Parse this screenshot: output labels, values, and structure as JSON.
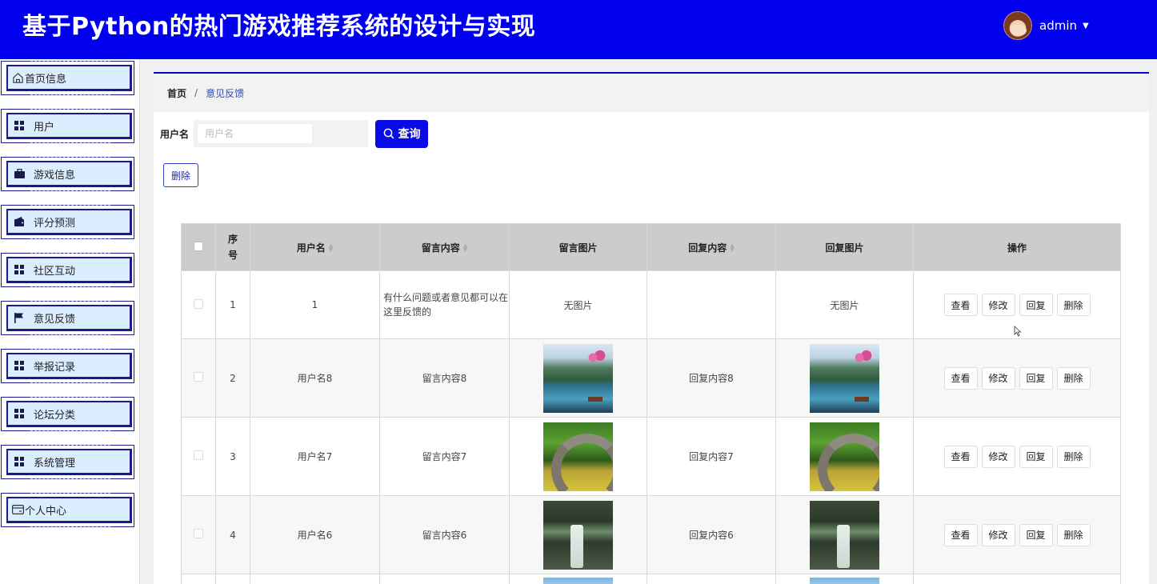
{
  "header": {
    "title": "基于Python的热门游戏推荐系统的设计与实现",
    "username": "admin"
  },
  "sidebar": {
    "items": [
      {
        "label": "首页信息",
        "icon": "home-icon"
      },
      {
        "label": "用户",
        "icon": "grid-icon"
      },
      {
        "label": "游戏信息",
        "icon": "briefcase-icon"
      },
      {
        "label": "评分预测",
        "icon": "wallet-icon"
      },
      {
        "label": "社区互动",
        "icon": "grid-icon"
      },
      {
        "label": "意见反馈",
        "icon": "flag-icon"
      },
      {
        "label": "举报记录",
        "icon": "grid-icon"
      },
      {
        "label": "论坛分类",
        "icon": "grid-icon"
      },
      {
        "label": "系统管理",
        "icon": "grid-icon"
      },
      {
        "label": "个人中心",
        "icon": "card-icon"
      }
    ]
  },
  "breadcrumb": {
    "home": "首页",
    "separator": "/",
    "current": "意见反馈"
  },
  "search": {
    "label": "用户名",
    "placeholder": "用户名",
    "value": "",
    "button": "查询"
  },
  "toolbar": {
    "delete_label": "删除"
  },
  "table": {
    "columns": [
      "序号",
      "用户名",
      "留言内容",
      "留言图片",
      "回复内容",
      "回复图片",
      "操作"
    ],
    "no_image_text": "无图片",
    "actions": [
      "查看",
      "修改",
      "回复",
      "删除"
    ],
    "rows": [
      {
        "index": "1",
        "username": "1",
        "message": "有什么问题或者意见都可以在这里反馈的",
        "message_image": "",
        "reply": "",
        "reply_image": ""
      },
      {
        "index": "2",
        "username": "用户名8",
        "message": "留言内容8",
        "message_image": "landscape-lake-image",
        "reply": "回复内容8",
        "reply_image": "landscape-lake-image"
      },
      {
        "index": "3",
        "username": "用户名7",
        "message": "留言内容7",
        "message_image": "stone-bridge-image",
        "reply": "回复内容7",
        "reply_image": "stone-bridge-image"
      },
      {
        "index": "4",
        "username": "用户名6",
        "message": "留言内容6",
        "message_image": "waterfall-image",
        "reply": "回复内容6",
        "reply_image": "waterfall-image"
      }
    ]
  },
  "colors": {
    "header_bg": "#0000ee",
    "accent": "#0a0ae6",
    "menu_bg": "#dbeeff",
    "table_header_bg": "#cccccc"
  }
}
